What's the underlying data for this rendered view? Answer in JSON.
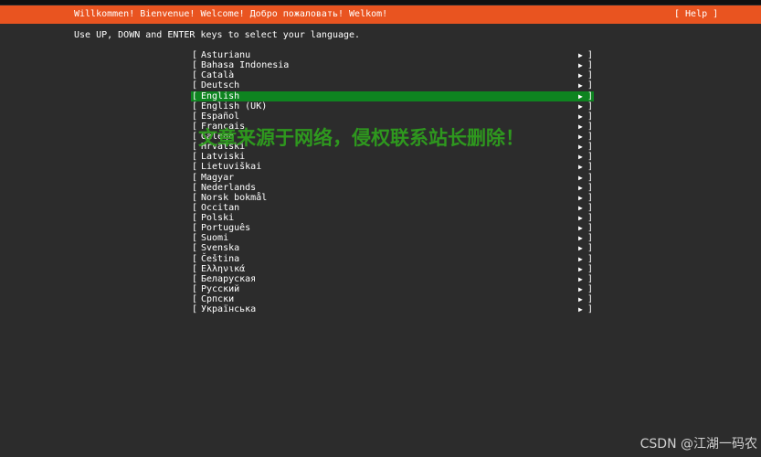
{
  "header": {
    "title": "Willkommen! Bienvenue! Welcome! Добро пожаловать! Welkom!",
    "help_label": "[ Help ]"
  },
  "instruction": "Use UP, DOWN and ENTER keys to select your language.",
  "bracket_left": "[",
  "bracket_right": "]",
  "arrow_glyph": "▶",
  "languages": [
    {
      "label": "Asturianu"
    },
    {
      "label": "Bahasa Indonesia"
    },
    {
      "label": "Català"
    },
    {
      "label": "Deutsch"
    },
    {
      "label": "English",
      "selected": true
    },
    {
      "label": "English (UK)"
    },
    {
      "label": "Español"
    },
    {
      "label": "Français"
    },
    {
      "label": "Galego"
    },
    {
      "label": "Hrvatski"
    },
    {
      "label": "Latviski"
    },
    {
      "label": "Lietuviškai"
    },
    {
      "label": "Magyar"
    },
    {
      "label": "Nederlands"
    },
    {
      "label": "Norsk bokmål"
    },
    {
      "label": "Occitan"
    },
    {
      "label": "Polski"
    },
    {
      "label": "Português"
    },
    {
      "label": "Suomi"
    },
    {
      "label": "Svenska"
    },
    {
      "label": "Čeština"
    },
    {
      "label": "Ελληνικά"
    },
    {
      "label": "Беларуская"
    },
    {
      "label": "Русский"
    },
    {
      "label": "Српски"
    },
    {
      "label": "Українська"
    }
  ],
  "watermark": "文章来源于网络，侵权联系站长删除！",
  "credit": "CSDN @江湖一码农",
  "colors": {
    "header_bg": "#e95420",
    "selected_bg": "#0e8420",
    "page_bg": "#2c2c2c",
    "watermark": "#2f9e1e"
  }
}
